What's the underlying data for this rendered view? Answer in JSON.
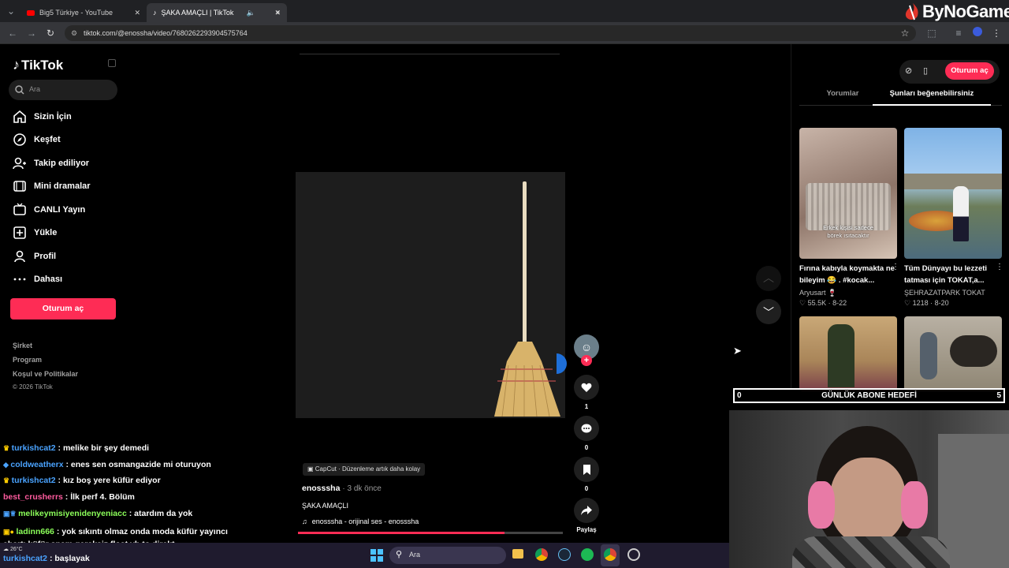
{
  "browser": {
    "tabs": [
      {
        "label": "Big5 Türkiye - YouTube"
      },
      {
        "label": "ŞAKA AMAÇLI | TikTok"
      }
    ],
    "url": "tiktok.com/@enossha/video/7680262293904575764"
  },
  "watermark": "ByNoGame",
  "sidebar": {
    "logo": "TikTok",
    "search_placeholder": "Ara",
    "items": [
      {
        "label": "Sizin İçin",
        "icon": "home-icon"
      },
      {
        "label": "Keşfet",
        "icon": "compass-icon"
      },
      {
        "label": "Takip ediliyor",
        "icon": "following-icon"
      },
      {
        "label": "Mini dramalar",
        "icon": "drama-icon"
      },
      {
        "label": "CANLI Yayın",
        "icon": "live-icon"
      },
      {
        "label": "Yükle",
        "icon": "upload-icon"
      },
      {
        "label": "Profil",
        "icon": "profile-icon"
      },
      {
        "label": "Dahası",
        "icon": "more-icon"
      }
    ],
    "login_button": "Oturum aç",
    "footer": [
      "Şirket",
      "Program",
      "Koşul ve Politikalar",
      "© 2026 TikTok"
    ]
  },
  "video": {
    "capcut_badge": "CapCut · Düzenleme artık daha kolay",
    "author": "enosssha",
    "time": "· 3 dk önce",
    "caption": "ŞAKA AMAÇLI",
    "sound": "enosssha - orijinal ses - enosssha",
    "likes": "1",
    "comments": "0",
    "saves": "0",
    "share_label": "Paylaş"
  },
  "right_panel": {
    "login_button": "Oturum aç",
    "tabs": [
      "Yorumlar",
      "Şunları beğenebilirsiniz"
    ],
    "active_tab": 1,
    "cards": [
      {
        "overlay": "Erkek kişisi sadece\nbörek ısıtacaktır",
        "title": "Fırına kabıyla koymakta ne bileyim 😂 . #kocak...",
        "author": "Aryusart 🍷",
        "meta": "♡ 55.5K · 8-22"
      },
      {
        "overlay": "",
        "title": "Tüm Dünyayı bu lezzeti tatması için TOKAT,a...",
        "author": "ŞEHRAZATPARK TOKAT",
        "meta": "♡ 1218 · 8-20"
      }
    ]
  },
  "goal_bar": {
    "left": "0",
    "label": "GÜNLÜK ABONE HEDEFİ",
    "right": "5"
  },
  "chat": [
    {
      "user": "turkishcat2",
      "color": "#4aa3ff",
      "msg": ": melike bir şey demedi"
    },
    {
      "user": "coldweatherx",
      "color": "#4aa3ff",
      "msg": ": enes sen osmangazide mi oturuyon"
    },
    {
      "user": "turkishcat2",
      "color": "#4aa3ff",
      "msg": ": kız boş yere küfür ediyor"
    },
    {
      "user": "best_crusherrs",
      "color": "#ff5b9e",
      "msg": ": İlk perf 4. Bölüm"
    },
    {
      "user": "melikeymisiyenidenyeniacc",
      "color": "#8cff5a",
      "msg": ": atardım da yok"
    },
    {
      "user": "ladinn666",
      "color": "#8cff5a",
      "msg": ": yok sıkıntı olmaz onda moda küfür yayıncı abartı küfür spam gereksiz float vb to direkt"
    },
    {
      "user": "turkishcat2",
      "color": "#4aa3ff",
      "msg": ": başlayak"
    }
  ],
  "taskbar": {
    "search": "Ara",
    "weather": "26°C"
  },
  "colors": {
    "accent": "#fe2c55",
    "bg": "#000000"
  }
}
